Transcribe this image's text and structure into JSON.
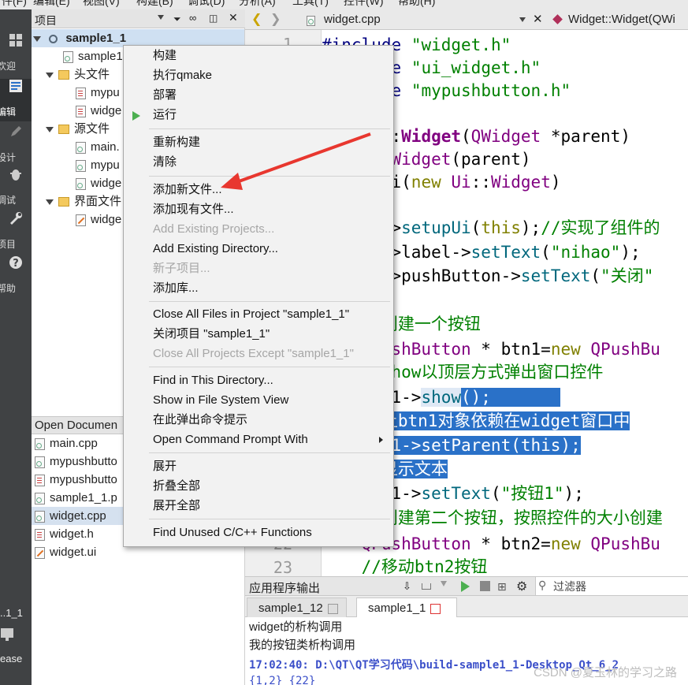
{
  "menubar": {
    "items": [
      "件(F)",
      "编辑(E)",
      "视图(V)",
      "构建(B)",
      "调试(D)",
      "分析(A)",
      "工具(T)",
      "控件(W)",
      "帮助(H)"
    ]
  },
  "modes": [
    {
      "label": "欢迎",
      "icon": "grid-icon"
    },
    {
      "label": "编辑",
      "icon": "edit-icon"
    },
    {
      "label": "设计",
      "icon": "pencil-icon"
    },
    {
      "label": "调试",
      "icon": "bug-icon"
    },
    {
      "label": "项目",
      "icon": "wrench-icon"
    },
    {
      "label": "帮助",
      "icon": "help-icon"
    }
  ],
  "kit": {
    "project": "..1_1",
    "build": "ease"
  },
  "projects": {
    "header": "项目",
    "root": "sample1_1",
    "items": [
      {
        "label": "sample1",
        "icon": "pro-file-icon"
      },
      {
        "label": "头文件",
        "icon": "folder-icon"
      },
      {
        "label": "mypu",
        "icon": "header-file-icon"
      },
      {
        "label": "widge",
        "icon": "header-file-icon"
      },
      {
        "label": "源文件",
        "icon": "folder-icon"
      },
      {
        "label": "main.",
        "icon": "cpp-file-icon"
      },
      {
        "label": "mypu",
        "icon": "cpp-file-icon"
      },
      {
        "label": "widge",
        "icon": "cpp-file-icon"
      },
      {
        "label": "界面文件",
        "icon": "folder-icon"
      },
      {
        "label": "widge",
        "icon": "ui-file-icon"
      }
    ]
  },
  "open_documents": {
    "header": "Open Documen",
    "items": [
      "main.cpp",
      "mypushbutto",
      "mypushbutto",
      "sample1_1.p",
      "widget.cpp",
      "widget.h",
      "widget.ui"
    ],
    "selected": "widget.cpp"
  },
  "editor": {
    "file": "widget.cpp",
    "symbol": "Widget::Widget(QWi",
    "line_numbers": [
      "1",
      "22",
      "23"
    ]
  },
  "context_menu": {
    "groups": [
      [
        {
          "label": "构建"
        },
        {
          "label": "执行qmake"
        },
        {
          "label": "部署"
        },
        {
          "label": "运行",
          "icon": "run-icon"
        }
      ],
      [
        {
          "label": "重新构建"
        },
        {
          "label": "清除"
        }
      ],
      [
        {
          "label": "添加新文件..."
        },
        {
          "label": "添加现有文件..."
        },
        {
          "label": "Add Existing Projects...",
          "disabled": true
        },
        {
          "label": "Add Existing Directory..."
        },
        {
          "label": "新子项目...",
          "disabled": true
        },
        {
          "label": "添加库..."
        }
      ],
      [
        {
          "label": "Close All Files in Project \"sample1_1\""
        },
        {
          "label": "关闭项目 \"sample1_1\""
        },
        {
          "label": "Close All Projects Except \"sample1_1\"",
          "disabled": true
        }
      ],
      [
        {
          "label": "Find in This Directory..."
        },
        {
          "label": "Show in File System View"
        },
        {
          "label": "在此弹出命令提示"
        },
        {
          "label": "Open Command Prompt With",
          "submenu": true
        }
      ],
      [
        {
          "label": "展开"
        },
        {
          "label": "折叠全部"
        },
        {
          "label": "展开全部"
        }
      ],
      [
        {
          "label": "Find Unused C/C++ Functions"
        }
      ]
    ]
  },
  "output": {
    "header": "应用程序输出",
    "filter_placeholder": "过滤器",
    "tabs": [
      "sample1_12",
      "sample1_1"
    ],
    "active_tab": "sample1_1",
    "lines": [
      "widget的析构调用",
      "我的按钮类析构调用",
      "17:02:40: D:\\QT\\QT学习代码\\build-sample1_1-Desktop_Qt_6_2",
      "{1,2} {22}"
    ]
  },
  "watermark": "CSDN @夏玉林的学习之路",
  "colors": {
    "accent_blue": "#2a71c8",
    "arrow_red": "#e8372f",
    "modebar": "#404244"
  }
}
